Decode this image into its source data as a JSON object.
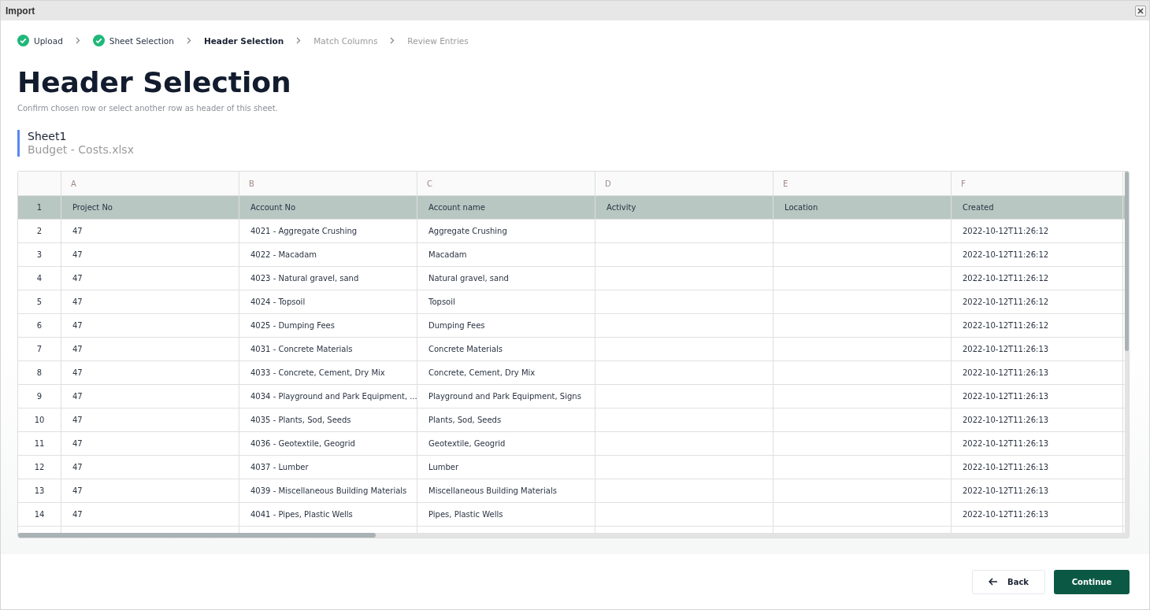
{
  "window": {
    "title": "Import"
  },
  "steps": [
    {
      "label": "Upload",
      "completed": true,
      "selected": false
    },
    {
      "label": "Sheet Selection",
      "completed": true,
      "selected": false
    },
    {
      "label": "Header Selection",
      "completed": false,
      "selected": true
    },
    {
      "label": "Match Columns",
      "completed": false,
      "selected": false
    },
    {
      "label": "Review Entries",
      "completed": false,
      "selected": false
    }
  ],
  "heading": "Header Selection",
  "subtitle": "Confirm chosen row or select another row as header of this sheet.",
  "sheet": {
    "name": "Sheet1",
    "file": "Budget - Costs.xlsx"
  },
  "table": {
    "columns": [
      "A",
      "B",
      "C",
      "D",
      "E",
      "F"
    ],
    "rows": [
      {
        "number": "1",
        "selected": true,
        "cells": [
          "Project No",
          "Account No",
          "Account name",
          "Activity",
          "Location",
          "Created"
        ]
      },
      {
        "number": "2",
        "selected": false,
        "cells": [
          "47",
          "4021 - Aggregate Crushing",
          "Aggregate Crushing",
          "",
          "",
          "2022-10-12T11:26:12"
        ]
      },
      {
        "number": "3",
        "selected": false,
        "cells": [
          "47",
          "4022 - Macadam",
          "Macadam",
          "",
          "",
          "2022-10-12T11:26:12"
        ]
      },
      {
        "number": "4",
        "selected": false,
        "cells": [
          "47",
          "4023 - Natural gravel, sand",
          "Natural gravel, sand",
          "",
          "",
          "2022-10-12T11:26:12"
        ]
      },
      {
        "number": "5",
        "selected": false,
        "cells": [
          "47",
          "4024 - Topsoil",
          "Topsoil",
          "",
          "",
          "2022-10-12T11:26:12"
        ]
      },
      {
        "number": "6",
        "selected": false,
        "cells": [
          "47",
          "4025 - Dumping Fees",
          "Dumping Fees",
          "",
          "",
          "2022-10-12T11:26:12"
        ]
      },
      {
        "number": "7",
        "selected": false,
        "cells": [
          "47",
          "4031 - Concrete Materials",
          "Concrete Materials",
          "",
          "",
          "2022-10-12T11:26:13"
        ]
      },
      {
        "number": "8",
        "selected": false,
        "cells": [
          "47",
          "4033 - Concrete, Cement, Dry Mix",
          "Concrete, Cement, Dry Mix",
          "",
          "",
          "2022-10-12T11:26:13"
        ]
      },
      {
        "number": "9",
        "selected": false,
        "cells": [
          "47",
          "4034 - Playground and Park Equipment, ...",
          "Playground and Park Equipment, Signs",
          "",
          "",
          "2022-10-12T11:26:13"
        ]
      },
      {
        "number": "10",
        "selected": false,
        "cells": [
          "47",
          "4035 - Plants, Sod, Seeds",
          "Plants, Sod, Seeds",
          "",
          "",
          "2022-10-12T11:26:13"
        ]
      },
      {
        "number": "11",
        "selected": false,
        "cells": [
          "47",
          "4036 - Geotextile, Geogrid",
          "Geotextile, Geogrid",
          "",
          "",
          "2022-10-12T11:26:13"
        ]
      },
      {
        "number": "12",
        "selected": false,
        "cells": [
          "47",
          "4037 - Lumber",
          "Lumber",
          "",
          "",
          "2022-10-12T11:26:13"
        ]
      },
      {
        "number": "13",
        "selected": false,
        "cells": [
          "47",
          "4039 - Miscellaneous Building Materials",
          "Miscellaneous Building Materials",
          "",
          "",
          "2022-10-12T11:26:13"
        ]
      },
      {
        "number": "14",
        "selected": false,
        "cells": [
          "47",
          "4041 - Pipes, Plastic Wells",
          "Pipes, Plastic Wells",
          "",
          "",
          "2022-10-12T11:26:13"
        ]
      }
    ]
  },
  "buttons": {
    "back": "Back",
    "continue": "Continue"
  }
}
